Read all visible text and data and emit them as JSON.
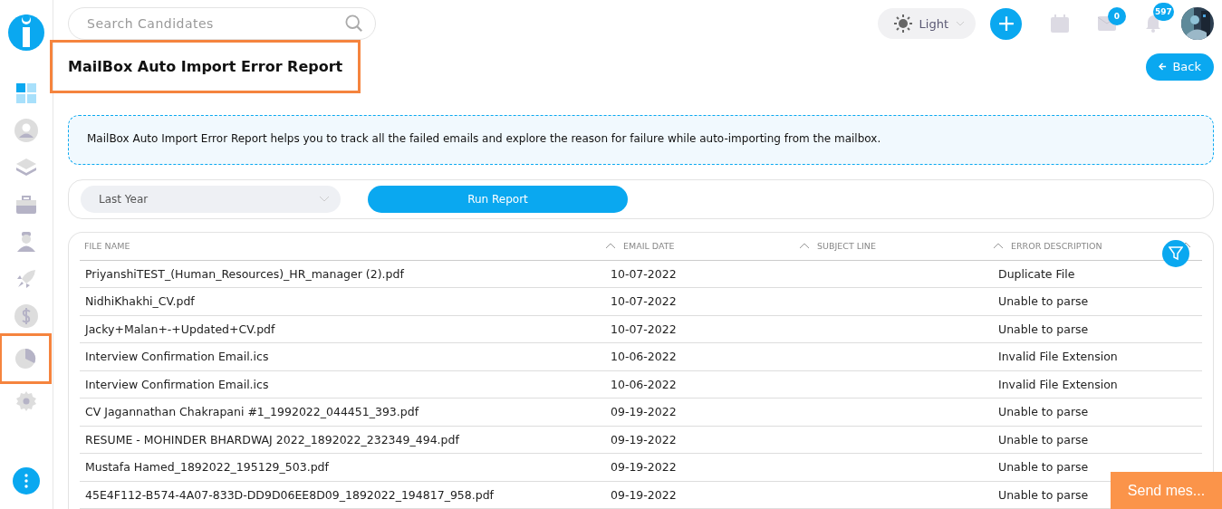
{
  "sidebar": {
    "items": [
      {
        "kind": "dashboard",
        "selected": false
      },
      {
        "kind": "person",
        "selected": false
      },
      {
        "kind": "layers",
        "selected": false
      },
      {
        "kind": "briefcase",
        "selected": false
      },
      {
        "kind": "worker",
        "selected": false
      },
      {
        "kind": "rocket",
        "selected": false
      },
      {
        "kind": "dollar",
        "selected": false
      },
      {
        "kind": "pie",
        "selected": true
      },
      {
        "kind": "gear",
        "selected": false
      }
    ]
  },
  "search": {
    "placeholder": "Search Candidates"
  },
  "theme": {
    "label": "Light"
  },
  "mail_badge": "0",
  "notification_badge": "597",
  "title": {
    "text": "MailBox Auto Import Error Report",
    "highlighted": true
  },
  "back_button": "Back",
  "info": "MailBox Auto Import Error Report helps you to track all the failed emails and explore the reason for failure while auto-importing from the mailbox.",
  "period": {
    "value": "Last Year"
  },
  "run_button": "Run Report",
  "table": {
    "columns": [
      "FILE NAME",
      "EMAIL DATE",
      "SUBJECT LINE",
      "ERROR DESCRIPTION"
    ],
    "rows": [
      [
        "PriyanshiTEST_(Human_Resources)_HR_manager (2).pdf",
        "10-07-2022",
        "",
        "Duplicate File"
      ],
      [
        "NidhiKhakhi_CV.pdf",
        "10-07-2022",
        "",
        "Unable to parse"
      ],
      [
        "Jacky+Malan+-+Updated+CV.pdf",
        "10-07-2022",
        "",
        "Unable to parse"
      ],
      [
        "Interview Confirmation Email.ics",
        "10-06-2022",
        "",
        "Invalid File Extension"
      ],
      [
        "Interview Confirmation Email.ics",
        "10-06-2022",
        "",
        "Invalid File Extension"
      ],
      [
        "CV Jagannathan Chakrapani #1_1992022_044451_393.pdf",
        "09-19-2022",
        "",
        "Unable to parse"
      ],
      [
        "RESUME - MOHINDER BHARDWAJ 2022_1892022_232349_494.pdf",
        "09-19-2022",
        "",
        "Unable to parse"
      ],
      [
        "Mustafa Hamed_1892022_195129_503.pdf",
        "09-19-2022",
        "",
        "Unable to parse"
      ],
      [
        "45E4F112-B574-4A07-833D-DD9D06EE8D09_1892022_194817_958.pdf",
        "09-19-2022",
        "",
        "Unable to parse"
      ]
    ]
  },
  "chat_button": "Send mes..."
}
